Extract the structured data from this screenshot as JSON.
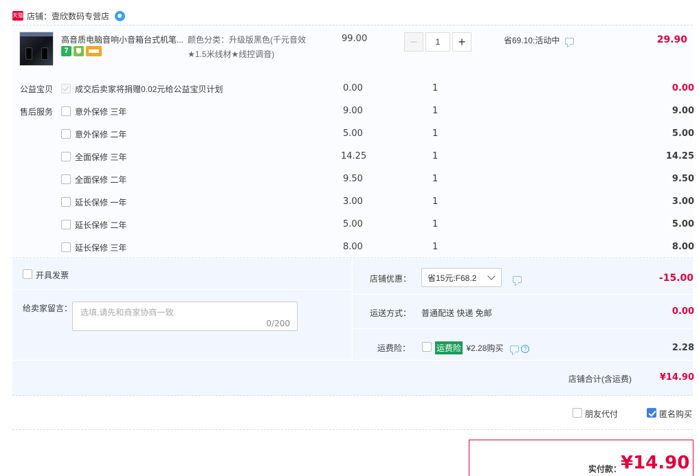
{
  "shop": {
    "badge": "天猫",
    "label": "店铺：壹欣数码专营店"
  },
  "product": {
    "title": "高音质电脑音响小音箱台式机笔...",
    "sku_line1": "颜色分类：升级版黑色(千元音效",
    "sku_line2": "★1.5米线材★线控调音)",
    "unit_price": "99.00",
    "quantity": "1",
    "promo": "省69.10:活动中",
    "subtotal": "29.90",
    "icons": [
      "seven-day-return-icon",
      "shield-icon",
      "credit-card-icon"
    ],
    "seven_label": "7"
  },
  "charity": {
    "label": "公益宝贝",
    "desc": "成交后卖家将捐赠0.02元给公益宝贝计划",
    "price": "0.00",
    "qty": "1",
    "subtotal": "0.00"
  },
  "services": {
    "label": "售后服务",
    "items": [
      {
        "name": "意外保修 三年",
        "price": "9.00",
        "qty": "1",
        "subtotal": "9.00"
      },
      {
        "name": "意外保修 二年",
        "price": "5.00",
        "qty": "1",
        "subtotal": "5.00"
      },
      {
        "name": "全面保修 三年",
        "price": "14.25",
        "qty": "1",
        "subtotal": "14.25"
      },
      {
        "name": "全面保修 二年",
        "price": "9.50",
        "qty": "1",
        "subtotal": "9.50"
      },
      {
        "name": "延长保修 一年",
        "price": "3.00",
        "qty": "1",
        "subtotal": "3.00"
      },
      {
        "name": "延长保修 二年",
        "price": "5.00",
        "qty": "1",
        "subtotal": "5.00"
      },
      {
        "name": "延长保修 三年",
        "price": "8.00",
        "qty": "1",
        "subtotal": "8.00"
      }
    ]
  },
  "invoice": {
    "label": "开具发票"
  },
  "message": {
    "label": "给卖家留言：",
    "placeholder": "选填,请先和商家协商一致",
    "counter": "0/200"
  },
  "discount": {
    "label": "店铺优惠：",
    "selected": "省15元:F68.2",
    "amount": "-15.00"
  },
  "shipping": {
    "label": "运送方式：",
    "method": "普通配送 快递 免邮",
    "amount": "0.00"
  },
  "insurance": {
    "label": "运费险：",
    "badge": "运费险",
    "desc": "¥2.28购买",
    "amount": "2.28"
  },
  "shop_total": {
    "label": "店铺合计(含运费)",
    "amount": "¥14.90"
  },
  "options": {
    "friend_pay": "朋友代付",
    "anonymous": "匿名购买"
  },
  "payment": {
    "label": "实付款：",
    "amount": "¥14.90"
  },
  "colors": {
    "accent_red": "#e4003a",
    "accent_blue": "#3e7fe0",
    "insurance_green": "#1a9d5a"
  }
}
